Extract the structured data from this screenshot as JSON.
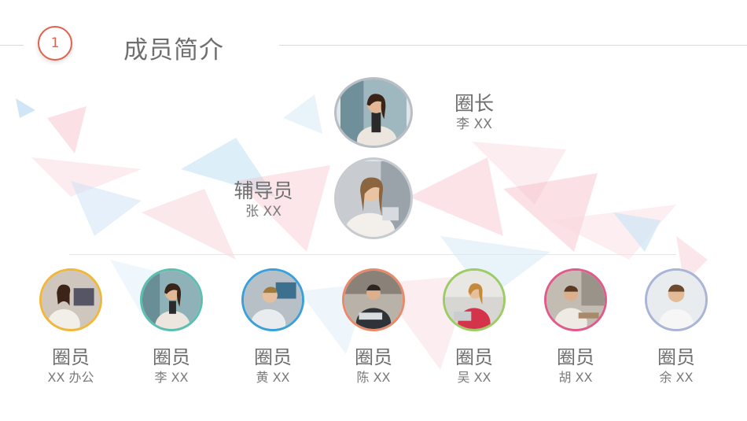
{
  "header": {
    "number": "1",
    "title": "成员简介"
  },
  "leader": {
    "role": "圈长",
    "name": "李 XX"
  },
  "advisor": {
    "role": "辅导员",
    "name": "张 XX"
  },
  "members": [
    {
      "role": "圈员",
      "name": "XX 办公",
      "ring": "#f0b73a"
    },
    {
      "role": "圈员",
      "name": "李 XX",
      "ring": "#5bbfb0"
    },
    {
      "role": "圈员",
      "name": "黄 XX",
      "ring": "#3aa0d9"
    },
    {
      "role": "圈员",
      "name": "陈 XX",
      "ring": "#e8896a"
    },
    {
      "role": "圈员",
      "name": "吴 XX",
      "ring": "#9ccc65"
    },
    {
      "role": "圈员",
      "name": "胡 XX",
      "ring": "#e05a8a"
    },
    {
      "role": "圈员",
      "name": "余 XX",
      "ring": "#a9b4d6"
    }
  ],
  "colors": {
    "accent": "#e0624e",
    "text": "#6f6f6f"
  }
}
